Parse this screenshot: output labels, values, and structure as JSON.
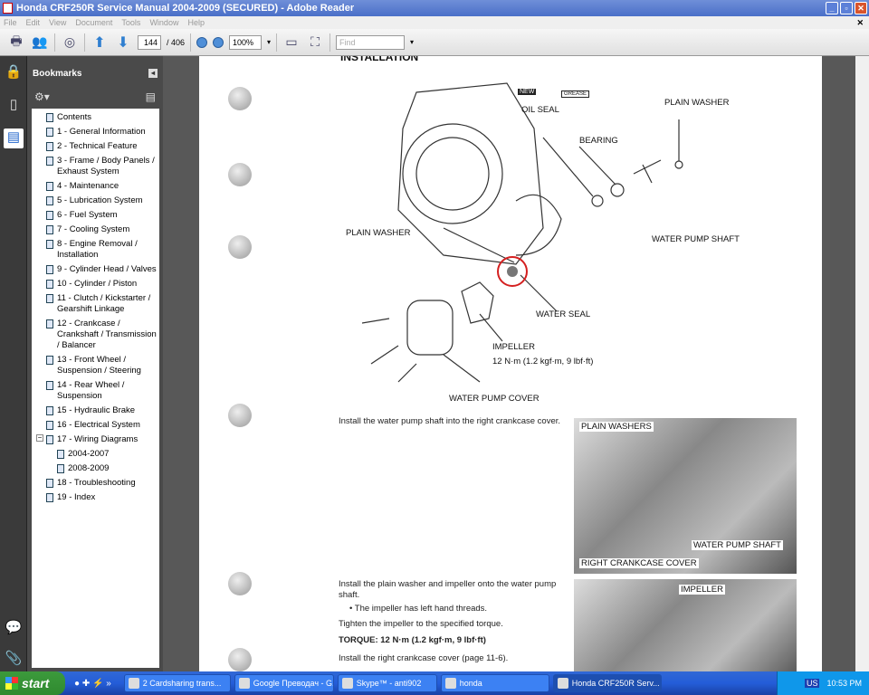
{
  "window": {
    "title": "Honda CRF250R Service Manual 2004-2009 (SECURED) - Adobe Reader"
  },
  "menu": [
    "File",
    "Edit",
    "View",
    "Document",
    "Tools",
    "Window",
    "Help"
  ],
  "toolbar": {
    "page_current": "144",
    "page_total": "/ 406",
    "zoom": "100%",
    "find_placeholder": "Find"
  },
  "bookmarks": {
    "title": "Bookmarks",
    "items": [
      {
        "label": "Contents"
      },
      {
        "label": "1 - General Information"
      },
      {
        "label": "2 - Technical Feature"
      },
      {
        "label": "3 - Frame / Body Panels / Exhaust System"
      },
      {
        "label": "4 - Maintenance"
      },
      {
        "label": "5 - Lubrication System"
      },
      {
        "label": "6 - Fuel System"
      },
      {
        "label": "7 - Cooling System"
      },
      {
        "label": "8 - Engine Removal / Installation"
      },
      {
        "label": "9 - Cylinder Head / Valves"
      },
      {
        "label": "10 - Cylinder / Piston"
      },
      {
        "label": "11 - Clutch / Kickstarter / Gearshift Linkage"
      },
      {
        "label": "12 - Crankcase / Crankshaft / Transmission / Balancer"
      },
      {
        "label": "13 - Front Wheel / Suspension / Steering"
      },
      {
        "label": "14 - Rear Wheel / Suspension"
      },
      {
        "label": "15 - Hydraulic Brake"
      },
      {
        "label": "16 - Electrical System"
      },
      {
        "label": "17 - Wiring Diagrams",
        "expanded": true
      },
      {
        "label": "2004-2007",
        "child": true
      },
      {
        "label": "2008-2009",
        "child": true
      },
      {
        "label": "18 - Troubleshooting"
      },
      {
        "label": "19 - Index"
      }
    ]
  },
  "page": {
    "heading": "INSTALLATION",
    "diagram_labels": {
      "oil_seal": "OIL SEAL",
      "plain_washer_top": "PLAIN WASHER",
      "bearing": "BEARING",
      "water_pump_shaft": "WATER PUMP SHAFT",
      "plain_washer": "PLAIN WASHER",
      "water_seal": "WATER SEAL",
      "impeller": "IMPELLER",
      "impeller_torque": "12 N·m (1.2 kgf·m, 9 lbf·ft)",
      "water_pump_cover": "WATER PUMP COVER",
      "new": "NEW",
      "grease": "GREASE"
    },
    "step1": "Install the water pump shaft into the right crankcase cover.",
    "photo1_labels": {
      "plain_washers": "PLAIN WASHERS",
      "water_pump_shaft": "WATER PUMP SHAFT",
      "right_crankcase_cover": "RIGHT CRANKCASE COVER"
    },
    "step2": "Install the plain washer and impeller onto the water pump shaft.",
    "note": "The impeller has left hand threads.",
    "step3": "Tighten the impeller to the specified torque.",
    "torque": "TORQUE: 12 N·m (1.2 kgf·m, 9 lbf·ft)",
    "step4": "Install the right crankcase cover (page 11-6).",
    "photo2_label": "IMPELLER"
  },
  "taskbar": {
    "start": "start",
    "buttons": [
      "2 Cardsharing trans...",
      "Google Преводач - G...",
      "Skype™ - anti902",
      "honda",
      "Honda CRF250R Serv..."
    ],
    "tray_lang": "US",
    "clock": "10:53 PM"
  },
  "colors": {
    "highlight_circle": "#d42020",
    "titlebar": "#4a6fc8",
    "taskbar": "#245dd8"
  }
}
